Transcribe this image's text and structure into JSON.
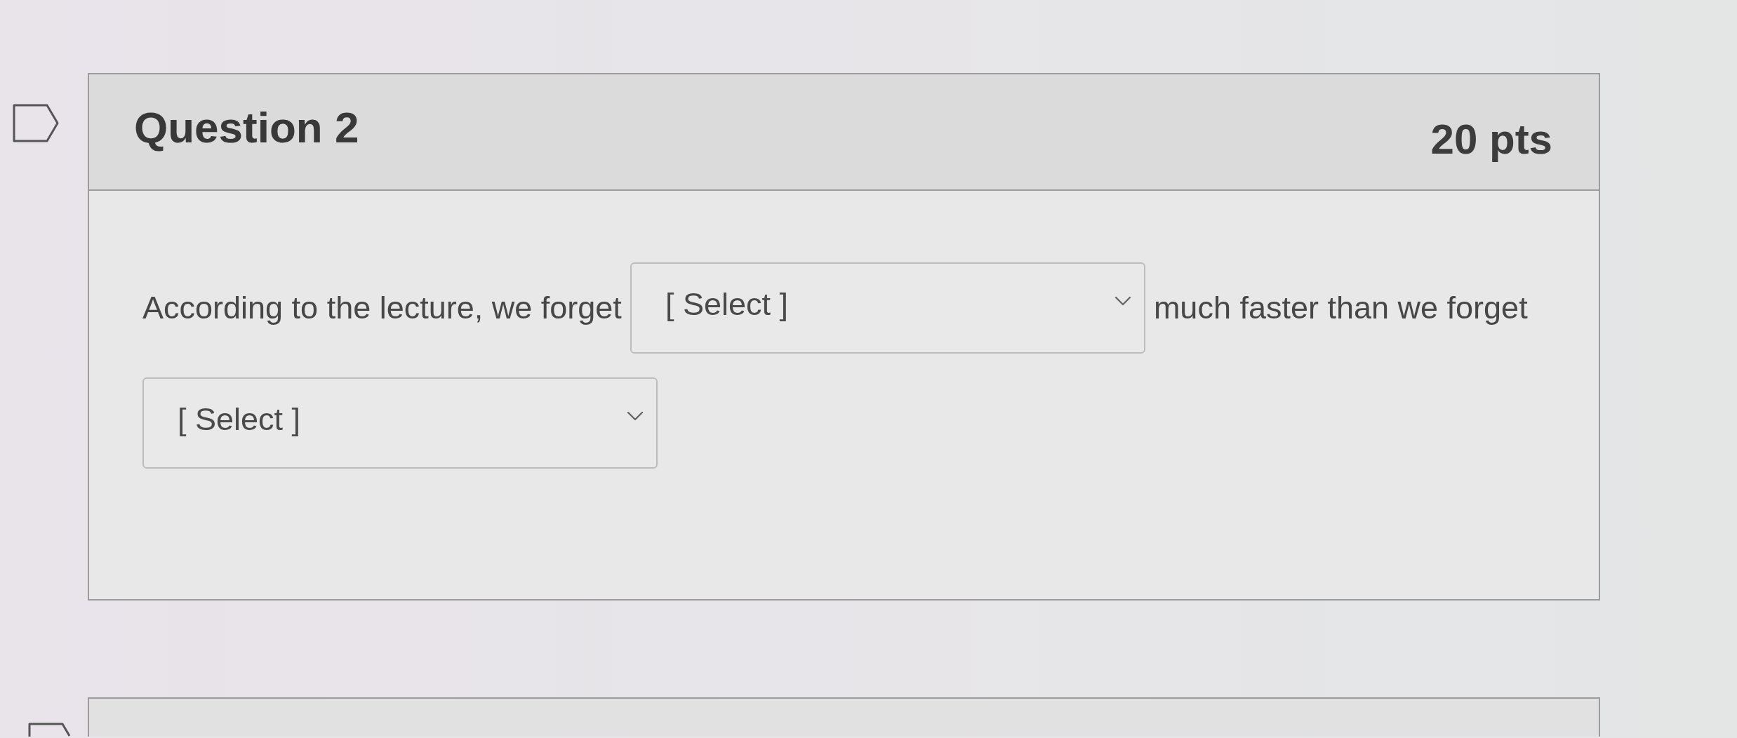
{
  "questions": [
    {
      "title": "Question 2",
      "points": "20 pts",
      "flagged": false,
      "body": [
        {
          "kind": "text",
          "text": "According to the lecture, we forget"
        },
        {
          "kind": "dropdown",
          "value": "[ Select ]"
        },
        {
          "kind": "text",
          "text": "much faster than we forget"
        },
        {
          "kind": "dropdown",
          "value": "[ Select ]"
        }
      ]
    },
    {
      "flagged": false
    }
  ]
}
